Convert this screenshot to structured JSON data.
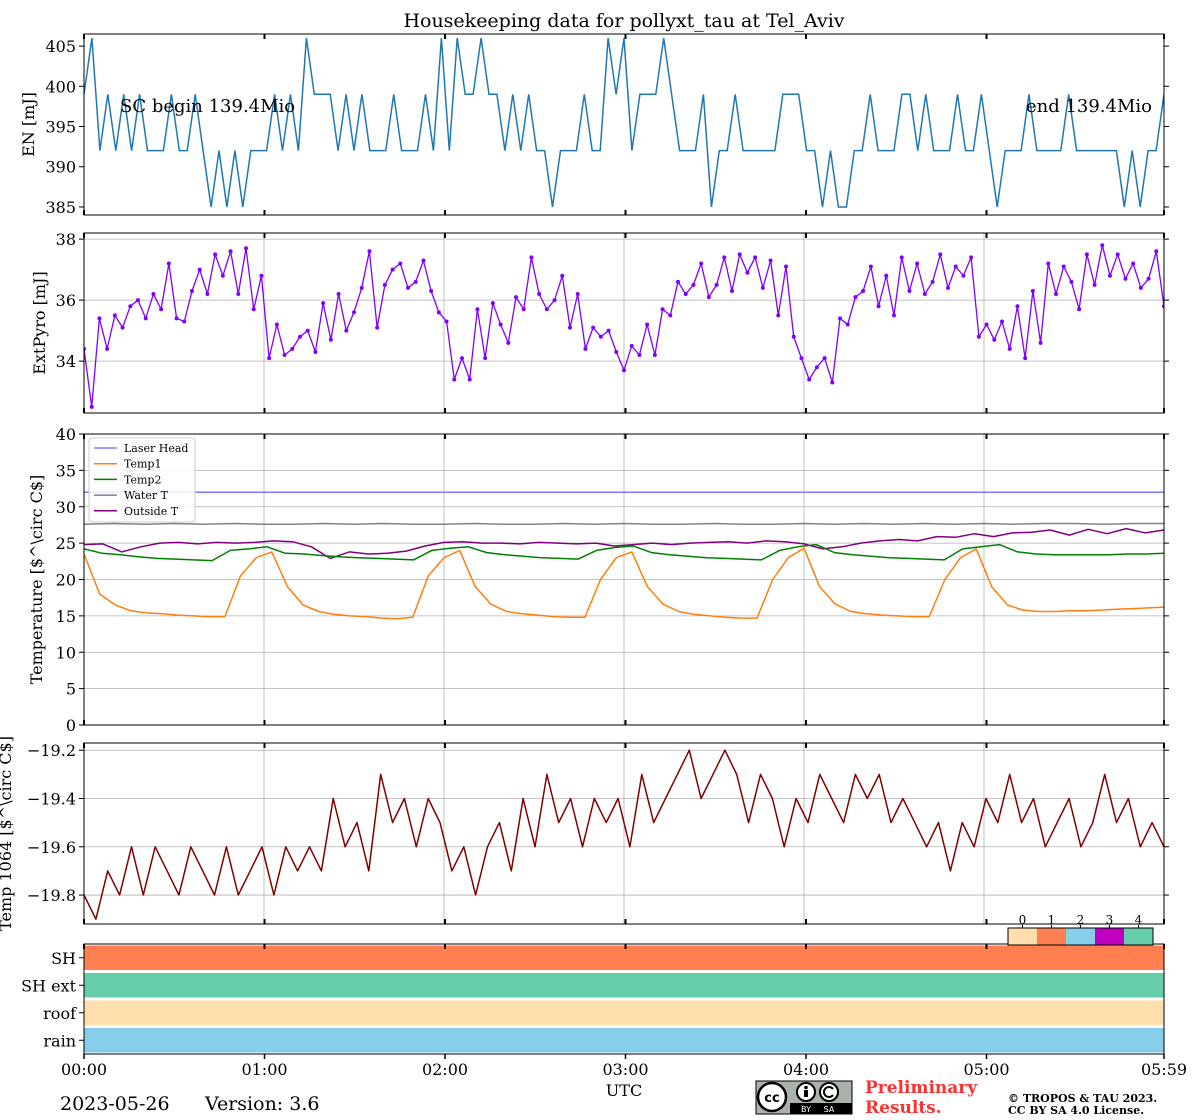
{
  "title": "Housekeeping data for pollyxt_tau at Tel_Aviv",
  "xlabel": "UTC",
  "x_ticks": [
    "00:00",
    "01:00",
    "02:00",
    "03:00",
    "04:00",
    "05:00",
    "05:59"
  ],
  "footer": {
    "date": "2023-05-26",
    "version": "Version: 3.6",
    "preliminary_line1": "Preliminary",
    "preliminary_line2": "Results.",
    "copyright_line1": "© TROPOS & TAU 2023.",
    "copyright_line2": "CC BY SA 4.0 License.",
    "license_badge": "cc-by-sa-icon",
    "license_badge_labels": [
      "BY",
      "SA"
    ]
  },
  "colors": {
    "en": "#1f77b4",
    "extpyro": "#8000ff",
    "laser_head": "#7b7bff",
    "temp1": "#ff7f0e",
    "temp2": "#008000",
    "water_t": "#808080",
    "outside_t": "#800080",
    "temp1064": "#800000",
    "status_0": "#ffdead",
    "status_1": "#ff7f50",
    "status_2": "#87ceeb",
    "status_3": "#c000c0",
    "status_4": "#66cdaa",
    "preliminary": "#ff3030"
  },
  "chart_data": [
    {
      "type": "line",
      "ylabel": "EN [mJ]",
      "ylim": [
        384,
        406.5
      ],
      "yticks": [
        385,
        390,
        395,
        400,
        405
      ],
      "annotations": [
        "SC begin 139.4Mio",
        "end 139.4Mio"
      ],
      "x_range_hours": [
        0,
        5.983
      ],
      "series": [
        {
          "values": [
            399,
            406,
            392,
            399,
            392,
            399,
            392,
            399,
            392,
            392,
            392,
            399,
            392,
            392,
            399,
            392,
            385,
            392,
            385,
            392,
            385,
            392,
            392,
            392,
            399,
            392,
            399,
            392,
            406,
            399,
            399,
            399,
            392,
            399,
            392,
            399,
            392,
            392,
            392,
            399,
            392,
            392,
            392,
            399,
            392,
            406,
            392,
            406,
            399,
            399,
            406,
            399,
            399,
            392,
            399,
            392,
            399,
            392,
            392,
            385,
            392,
            392,
            392,
            399,
            392,
            392,
            406,
            399,
            406,
            392,
            399,
            399,
            399,
            406,
            399,
            392,
            392,
            392,
            399,
            385,
            392,
            392,
            399,
            392,
            392,
            392,
            392,
            392,
            399,
            399,
            399,
            392,
            392,
            385,
            392,
            385,
            385,
            392,
            392,
            399,
            392,
            392,
            392,
            399,
            399,
            392,
            399,
            392,
            392,
            392,
            399,
            392,
            392,
            399,
            392,
            385,
            392,
            392,
            392,
            399,
            392,
            392,
            392,
            392,
            399,
            392,
            392,
            392,
            392,
            392,
            392,
            385,
            392,
            385,
            392,
            392,
            399
          ]
        }
      ]
    },
    {
      "type": "line",
      "ylabel": "ExtPyro [mJ]",
      "ylim": [
        32.3,
        38.2
      ],
      "yticks": [
        34,
        36,
        38
      ],
      "x_range_hours": [
        0,
        5.983
      ],
      "series": [
        {
          "values": [
            34.4,
            32.5,
            35.4,
            34.4,
            35.5,
            35.1,
            35.8,
            36,
            35.4,
            36.2,
            35.7,
            37.2,
            35.4,
            35.3,
            36.3,
            37,
            36.2,
            37.5,
            36.8,
            37.6,
            36.2,
            37.7,
            35.7,
            36.8,
            34.1,
            35.2,
            34.2,
            34.4,
            34.8,
            35,
            34.3,
            35.9,
            34.7,
            36.2,
            35,
            35.6,
            36.4,
            37.6,
            35.1,
            36.5,
            37,
            37.2,
            36.4,
            36.6,
            37.3,
            36.3,
            35.6,
            35.3,
            33.4,
            34.1,
            33.4,
            35.7,
            34.1,
            35.9,
            35.2,
            34.6,
            36.1,
            35.7,
            37.4,
            36.2,
            35.7,
            36,
            36.8,
            35.1,
            36.2,
            34.4,
            35.1,
            34.8,
            35,
            34.3,
            33.7,
            34.5,
            34.2,
            35.2,
            34.2,
            35.7,
            35.5,
            36.6,
            36.2,
            36.5,
            37.2,
            36.1,
            36.5,
            37.4,
            36.3,
            37.5,
            36.9,
            37.4,
            36.4,
            37.3,
            35.5,
            37.1,
            34.8,
            34.1,
            33.4,
            33.8,
            34.1,
            33.3,
            35.4,
            35.2,
            36.1,
            36.3,
            37.1,
            35.8,
            36.8,
            35.5,
            37.4,
            36.3,
            37.2,
            36.2,
            36.6,
            37.5,
            36.4,
            37.1,
            36.8,
            37.4,
            34.8,
            35.2,
            34.7,
            35.3,
            34.4,
            35.8,
            34.1,
            36.3,
            34.6,
            37.2,
            36.2,
            37.1,
            36.6,
            35.7,
            37.5,
            36.5,
            37.8,
            36.8,
            37.5,
            36.7,
            37.2,
            36.4,
            36.7,
            37.6,
            35.8
          ]
        }
      ]
    },
    {
      "type": "line",
      "ylabel": "Temperature [$^\\circ C$]",
      "ylim": [
        0,
        40
      ],
      "yticks": [
        0,
        5,
        10,
        15,
        20,
        25,
        30,
        35,
        40
      ],
      "legend_position": "upper-left",
      "x_range_hours": [
        0,
        5.983
      ],
      "series": [
        {
          "name": "Laser Head",
          "values": [
            32,
            32
          ]
        },
        {
          "name": "Temp1",
          "values": [
            23.5,
            18,
            16.5,
            15.7,
            15.4,
            15.3,
            15.1,
            15,
            14.9,
            14.9,
            20.5,
            23,
            23.8,
            19,
            16.5,
            15.6,
            15.2,
            15,
            14.9,
            14.7,
            14.6,
            14.8,
            20.5,
            23,
            24,
            19,
            16.6,
            15.6,
            15.3,
            15.1,
            14.9,
            14.8,
            14.8,
            20,
            23,
            23.8,
            19,
            16.6,
            15.6,
            15.2,
            15,
            14.8,
            14.7,
            14.7,
            20,
            23,
            24.3,
            19,
            16.6,
            15.6,
            15.3,
            15.1,
            15,
            14.9,
            14.9,
            20,
            23,
            24.2,
            19,
            16.5,
            15.8,
            15.6,
            15.6,
            15.7,
            15.7,
            15.8,
            15.9,
            16,
            16.1,
            16.2
          ]
        },
        {
          "name": "Temp2",
          "values": [
            24.2,
            23.6,
            23.4,
            23.1,
            22.9,
            22.8,
            22.7,
            22.6,
            24,
            24.2,
            24.5,
            23.6,
            23.5,
            23.3,
            23.1,
            23,
            22.9,
            22.8,
            22.7,
            24,
            24.3,
            24.5,
            23.7,
            23.4,
            23.2,
            23,
            22.9,
            22.8,
            24,
            24.4,
            24.6,
            23.7,
            23.4,
            23.2,
            23,
            22.9,
            22.8,
            22.7,
            24,
            24.5,
            24.8,
            23.7,
            23.4,
            23.2,
            23,
            22.9,
            22.8,
            22.7,
            24.2,
            24.5,
            24.8,
            23.8,
            23.5,
            23.4,
            23.4,
            23.4,
            23.4,
            23.5,
            23.5,
            23.6
          ]
        },
        {
          "name": "Water T",
          "values": [
            27.6,
            27.7,
            27.6,
            27.7,
            27.6,
            27.7,
            27.6,
            27.6,
            27.7,
            27.6,
            27.7,
            27.6,
            27.6,
            27.7,
            27.6,
            27.6,
            27.7,
            27.6,
            27.7,
            27.6,
            27.6,
            27.7,
            27.6,
            27.6,
            27.7,
            27.6,
            27.7,
            27.6,
            27.7,
            27.6,
            27.7,
            27.6,
            27.7,
            27.7,
            27.6,
            27.7,
            27.7
          ]
        },
        {
          "name": "Outside T",
          "values": [
            24.8,
            24.9,
            23.8,
            24.5,
            25,
            25.1,
            24.9,
            25.1,
            25,
            25.1,
            25.3,
            25.2,
            24.5,
            22.9,
            23.8,
            23.5,
            23.6,
            23.9,
            24.6,
            25.1,
            25.2,
            25,
            25,
            24.9,
            25.1,
            25,
            24.9,
            25,
            24.6,
            24.8,
            25,
            24.8,
            25,
            25.1,
            25.2,
            25,
            25.3,
            25.2,
            24.9,
            24.2,
            24.5,
            25,
            25.3,
            25.5,
            25.3,
            25.9,
            25.8,
            26.3,
            25.9,
            26.4,
            26.5,
            26.8,
            26.1,
            26.9,
            26.3,
            27,
            26.4,
            26.8
          ]
        }
      ]
    },
    {
      "type": "line",
      "ylabel": "Temp 1064 [$^\\circ C$]",
      "ylim": [
        -19.92,
        -19.17
      ],
      "yticks": [
        -19.8,
        -19.6,
        -19.4,
        -19.2
      ],
      "x_range_hours": [
        0,
        5.983
      ],
      "series": [
        {
          "values": [
            -19.8,
            -19.9,
            -19.7,
            -19.8,
            -19.6,
            -19.8,
            -19.6,
            -19.7,
            -19.8,
            -19.6,
            -19.7,
            -19.8,
            -19.6,
            -19.8,
            -19.7,
            -19.6,
            -19.8,
            -19.6,
            -19.7,
            -19.6,
            -19.7,
            -19.4,
            -19.6,
            -19.5,
            -19.7,
            -19.3,
            -19.5,
            -19.4,
            -19.6,
            -19.4,
            -19.5,
            -19.7,
            -19.6,
            -19.8,
            -19.6,
            -19.5,
            -19.7,
            -19.4,
            -19.6,
            -19.3,
            -19.5,
            -19.4,
            -19.6,
            -19.4,
            -19.5,
            -19.4,
            -19.6,
            -19.3,
            -19.5,
            -19.4,
            -19.3,
            -19.2,
            -19.4,
            -19.3,
            -19.2,
            -19.3,
            -19.5,
            -19.3,
            -19.4,
            -19.6,
            -19.4,
            -19.5,
            -19.3,
            -19.4,
            -19.5,
            -19.3,
            -19.4,
            -19.3,
            -19.5,
            -19.4,
            -19.5,
            -19.6,
            -19.5,
            -19.7,
            -19.5,
            -19.6,
            -19.4,
            -19.5,
            -19.3,
            -19.5,
            -19.4,
            -19.6,
            -19.5,
            -19.4,
            -19.6,
            -19.5,
            -19.3,
            -19.5,
            -19.4,
            -19.6,
            -19.5,
            -19.6
          ]
        }
      ]
    },
    {
      "type": "heatmap",
      "categories": [
        "SH",
        "SH ext",
        "roof",
        "rain"
      ],
      "values": [
        1,
        4,
        0,
        2
      ],
      "colorbar_ticks": [
        "0",
        "1",
        "2",
        "3",
        "4"
      ]
    }
  ]
}
